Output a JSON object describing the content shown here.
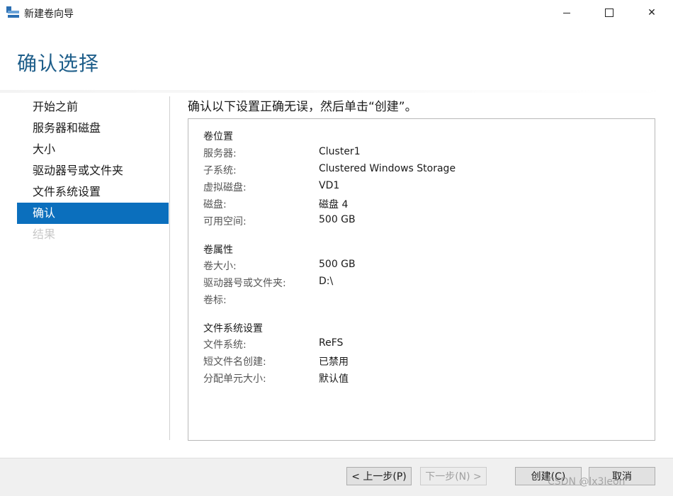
{
  "window": {
    "title": "新建卷向导",
    "icons": [
      "app-icon",
      "minimize-icon",
      "maximize-icon",
      "close-icon"
    ],
    "close_glyph": "✕"
  },
  "page": {
    "title": "确认选择",
    "instruction": "确认以下设置正确无误，然后单击“创建”。"
  },
  "nav": {
    "items": [
      {
        "label": "开始之前",
        "state": "normal"
      },
      {
        "label": "服务器和磁盘",
        "state": "normal"
      },
      {
        "label": "大小",
        "state": "normal"
      },
      {
        "label": "驱动器号或文件夹",
        "state": "normal"
      },
      {
        "label": "文件系统设置",
        "state": "normal"
      },
      {
        "label": "确认",
        "state": "active"
      },
      {
        "label": "结果",
        "state": "disabled"
      }
    ],
    "active_color": "#0b6fbd"
  },
  "summary": {
    "volume_location": {
      "heading": "卷位置",
      "rows": [
        {
          "label": "服务器:",
          "value": "Cluster1"
        },
        {
          "label": "子系统:",
          "value": "Clustered Windows Storage"
        },
        {
          "label": "虚拟磁盘:",
          "value": "VD1"
        },
        {
          "label": "磁盘:",
          "value": "磁盘 4"
        },
        {
          "label": "可用空间:",
          "value": "500 GB"
        }
      ]
    },
    "volume_properties": {
      "heading": "卷属性",
      "rows": [
        {
          "label": "卷大小:",
          "value": "500 GB"
        },
        {
          "label": "驱动器号或文件夹:",
          "value": "D:\\"
        },
        {
          "label": "卷标:",
          "value": ""
        }
      ]
    },
    "filesystem_settings": {
      "heading": "文件系统设置",
      "rows": [
        {
          "label": "文件系统:",
          "value": "ReFS"
        },
        {
          "label": "短文件名创建:",
          "value": "已禁用"
        },
        {
          "label": "分配单元大小:",
          "value": "默认值"
        }
      ]
    }
  },
  "buttons": {
    "prev": "< 上一步(P)",
    "next": "下一步(N) >",
    "create": "创建(C)",
    "cancel": "取消"
  },
  "watermark": "CSDN @lx3leon"
}
